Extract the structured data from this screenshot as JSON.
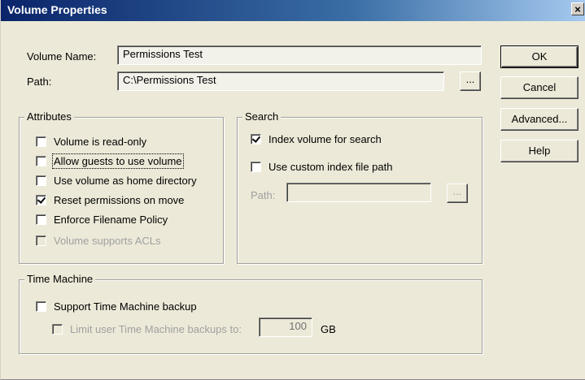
{
  "window": {
    "title": "Volume Properties",
    "close_glyph": "×"
  },
  "fields": {
    "volume_name_label": "Volume Name:",
    "volume_name_value": "Permissions Test",
    "path_label": "Path:",
    "path_value": "C:\\Permissions Test",
    "browse_label": "..."
  },
  "buttons": {
    "ok": "OK",
    "cancel": "Cancel",
    "advanced": "Advanced...",
    "help": "Help"
  },
  "attributes": {
    "title": "Attributes",
    "items": [
      {
        "label": "Volume is read-only",
        "checked": false,
        "enabled": true
      },
      {
        "label": "Allow guests to use volume",
        "checked": false,
        "enabled": true
      },
      {
        "label": "Use volume as home directory",
        "checked": false,
        "enabled": true
      },
      {
        "label": "Reset permissions on move",
        "checked": true,
        "enabled": true
      },
      {
        "label": "Enforce Filename Policy",
        "checked": false,
        "enabled": true
      },
      {
        "label": "Volume supports ACLs",
        "checked": false,
        "enabled": false
      }
    ]
  },
  "search": {
    "title": "Search",
    "index_label": "Index volume for search",
    "index_checked": true,
    "custom_path_label": "Use custom index file path",
    "custom_path_checked": false,
    "path_label": "Path:",
    "path_value": "",
    "browse_label": "..."
  },
  "time_machine": {
    "title": "Time Machine",
    "support_label": "Support Time Machine backup",
    "support_checked": false,
    "limit_label": "Limit user Time Machine backups to:",
    "limit_checked": false,
    "limit_value": "100",
    "limit_unit": "GB"
  }
}
